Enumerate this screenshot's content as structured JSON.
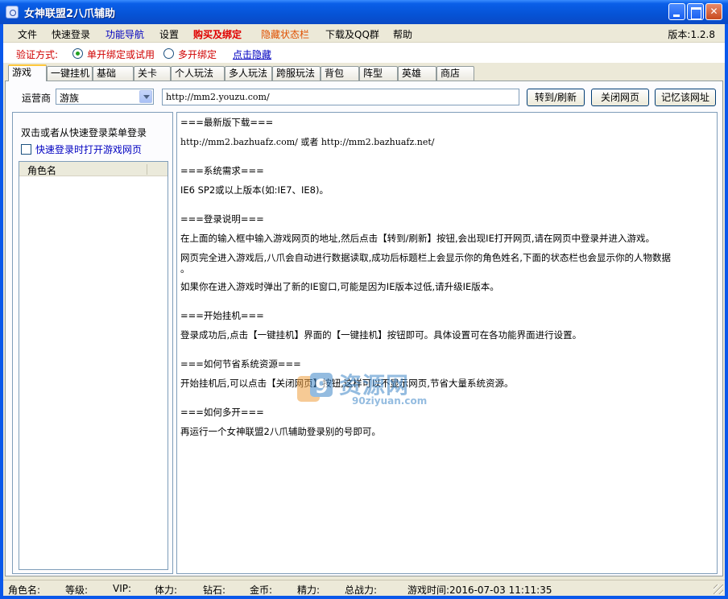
{
  "window": {
    "title": "女神联盟2八爪辅助",
    "colors": {
      "titlebar": "#0a5fe8",
      "face": "#ece9d8",
      "accent_red": "#d00000",
      "link_blue": "#0000c0"
    }
  },
  "menu": {
    "items": [
      {
        "label": "文件",
        "color": "#000000"
      },
      {
        "label": "快速登录",
        "color": "#000000"
      },
      {
        "label": "功能导航",
        "color": "#0000c0"
      },
      {
        "label": "设置",
        "color": "#000000"
      },
      {
        "label": "购买及绑定",
        "color": "#e00000"
      },
      {
        "label": "隐藏状态栏",
        "color": "#e05000"
      },
      {
        "label": "下载及QQ群",
        "color": "#000000"
      },
      {
        "label": "帮助",
        "color": "#000000"
      }
    ],
    "version": "版本:1.2.8"
  },
  "verify": {
    "label": "验证方式:",
    "options": [
      {
        "label": "单开绑定或试用",
        "selected": true
      },
      {
        "label": "多开绑定",
        "selected": false
      }
    ],
    "hide_link": "点击隐藏"
  },
  "tabs": [
    {
      "label": "游戏",
      "active": true
    },
    {
      "label": "一键挂机"
    },
    {
      "label": "基础"
    },
    {
      "label": "关卡"
    },
    {
      "label": "个人玩法"
    },
    {
      "label": "多人玩法"
    },
    {
      "label": "跨服玩法"
    },
    {
      "label": "背包"
    },
    {
      "label": "阵型"
    },
    {
      "label": "英雄"
    },
    {
      "label": "商店"
    }
  ],
  "toolbar": {
    "operator_label": "运营商",
    "operator_value": "游族",
    "url": "http://mm2.youzu.com/",
    "goto_button": "转到/刷新",
    "close_button": "关闭网页",
    "remember_button": "记忆该网址"
  },
  "left_panel": {
    "hint": "双击或者从快速登录菜单登录",
    "checkbox_label": "快速登录时打开游戏网页",
    "checkbox_checked": false,
    "list_header": "角色名"
  },
  "info_lines": [
    "===最新版下载===",
    "http://mm2.bazhuafz.com/ 或者 http://mm2.bazhuafz.net/",
    "===系统需求===",
    "IE6 SP2或以上版本(如:IE7、IE8)。",
    "===登录说明===",
    "在上面的输入框中输入游戏网页的地址,然后点击【转到/刷新】按钮,会出现IE打开网页,请在网页中登录并进入游戏。",
    "网页完全进入游戏后,八爪会自动进行数据读取,成功后标题栏上会显示你的角色姓名,下面的状态栏也会显示你的人物数据",
    "。",
    "如果你在进入游戏时弹出了新的IE窗口,可能是因为IE版本过低,请升级IE版本。",
    "===开始挂机===",
    "登录成功后,点击【一键挂机】界面的【一键挂机】按钮即可。具体设置可在各功能界面进行设置。",
    "===如何节省系统资源===",
    "开始挂机后,可以点击【关闭网页】按钮,这样可以不显示网页,节省大量系统资源。",
    "===如何多开===",
    "再运行一个女神联盟2八爪辅助登录别的号即可。"
  ],
  "watermark": {
    "text": "资源网",
    "sub": "90ziyuan.com",
    "digits": "9"
  },
  "status": {
    "items": [
      "角色名:",
      "等级:",
      "VIP:",
      "体力:",
      "钻石:",
      "金币:",
      "精力:",
      "总战力:",
      "游戏时间:2016-07-03 11:11:35"
    ]
  }
}
